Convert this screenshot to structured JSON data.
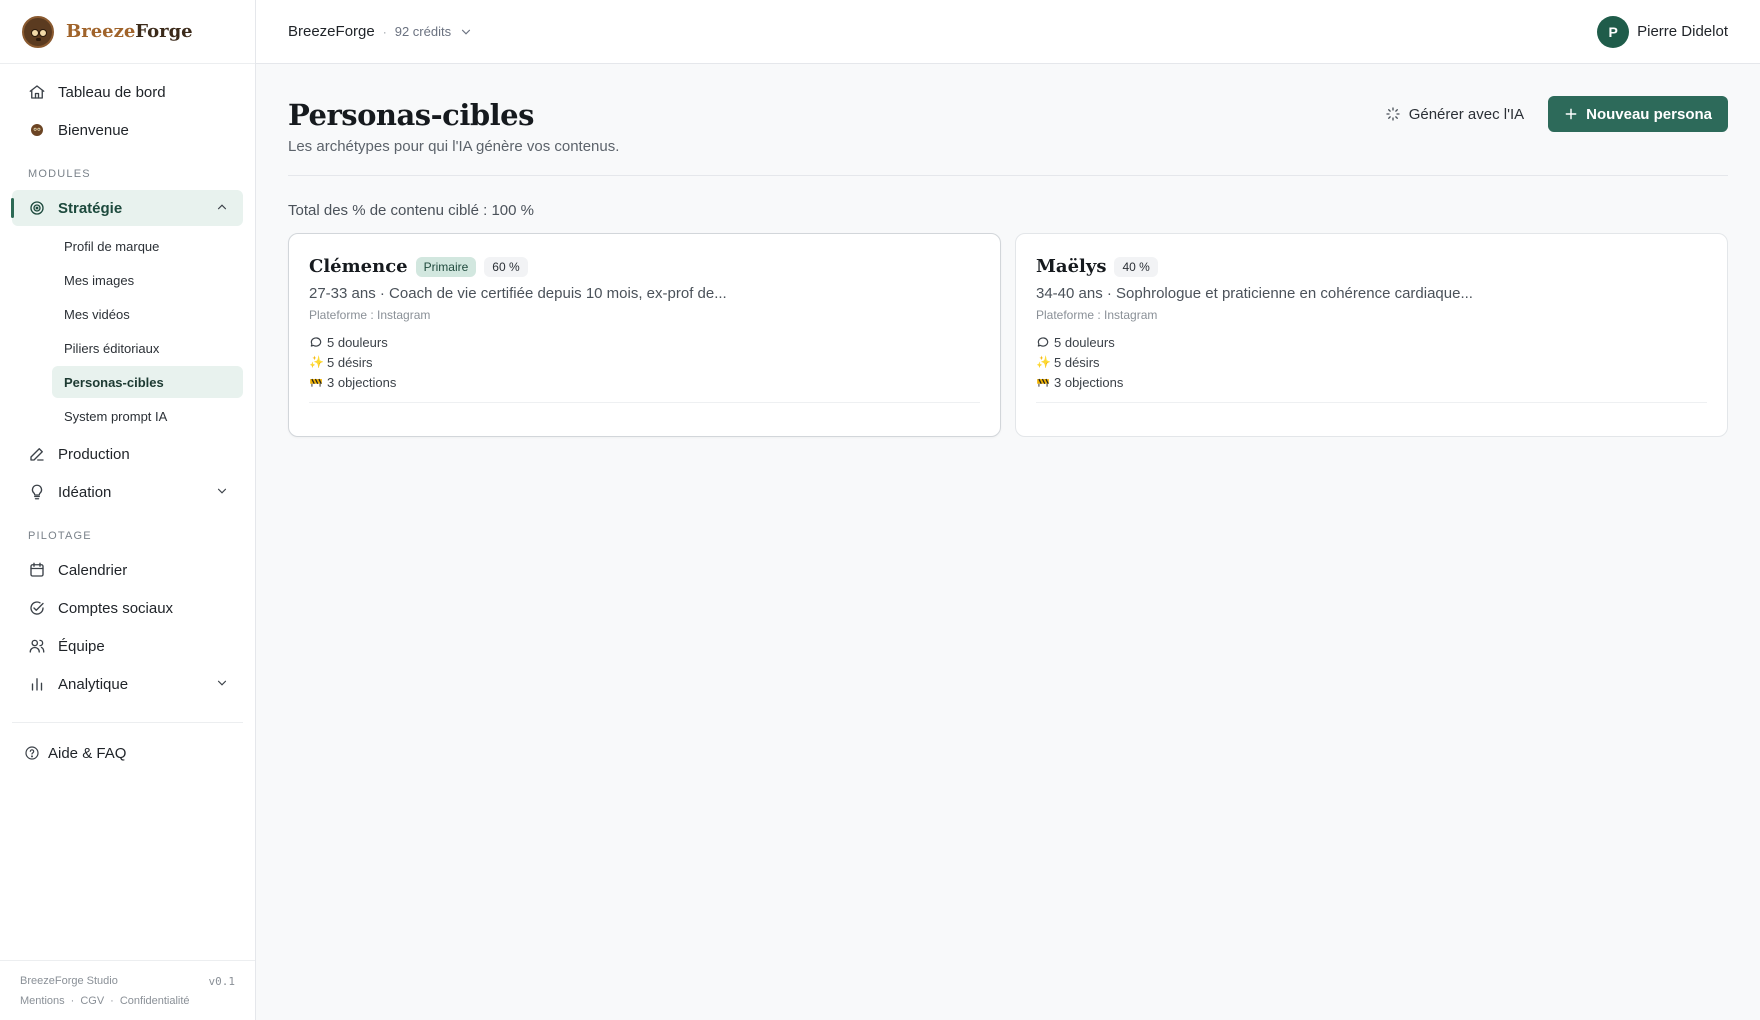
{
  "brand": {
    "name_part1": "Breeze",
    "name_part2": "Forge"
  },
  "nav": {
    "dashboard": "Tableau de bord",
    "welcome": "Bienvenue",
    "modules_label": "MODULES",
    "strategy": "Stratégie",
    "strategy_items": [
      "Profil de marque",
      "Mes images",
      "Mes vidéos",
      "Piliers éditoriaux",
      "Personas-cibles",
      "System prompt IA"
    ],
    "production": "Production",
    "ideation": "Idéation",
    "pilotage_label": "PILOTAGE",
    "calendar": "Calendrier",
    "social": "Comptes sociaux",
    "team": "Équipe",
    "analytics": "Analytique",
    "help": "Aide & FAQ"
  },
  "footer": {
    "studio": "BreezeForge Studio",
    "version": "v0.1",
    "links": [
      "Mentions",
      "CGV",
      "Confidentialité"
    ]
  },
  "topbar": {
    "workspace": "BreezeForge",
    "credits": "92 crédits",
    "user_initial": "P",
    "user_name": "Pierre Didelot"
  },
  "page": {
    "title": "Personas-cibles",
    "subtitle": "Les archétypes pour qui l'IA génère vos contenus.",
    "generate_label": "Générer avec l'IA",
    "new_label": "Nouveau persona",
    "total": "Total des % de contenu ciblé : 100 %"
  },
  "personas": [
    {
      "name": "Clémence",
      "badge": "Primaire",
      "percent": "60 %",
      "desc": "27-33 ans · Coach de vie certifiée depuis 10 mois, ex-prof de...",
      "platform": "Plateforme : Instagram",
      "pains": "5 douleurs",
      "desires": "5 désirs",
      "objections": "3 objections"
    },
    {
      "name": "Maëlys",
      "percent": "40 %",
      "desc": "34-40 ans · Sophrologue et praticienne en cohérence cardiaque...",
      "platform": "Plateforme : Instagram",
      "pains": "5 douleurs",
      "desires": "5 désirs",
      "objections": "3 objections"
    }
  ],
  "colors": {
    "accent": "#2d6a5a",
    "active_bg": "#e8f2ee"
  }
}
